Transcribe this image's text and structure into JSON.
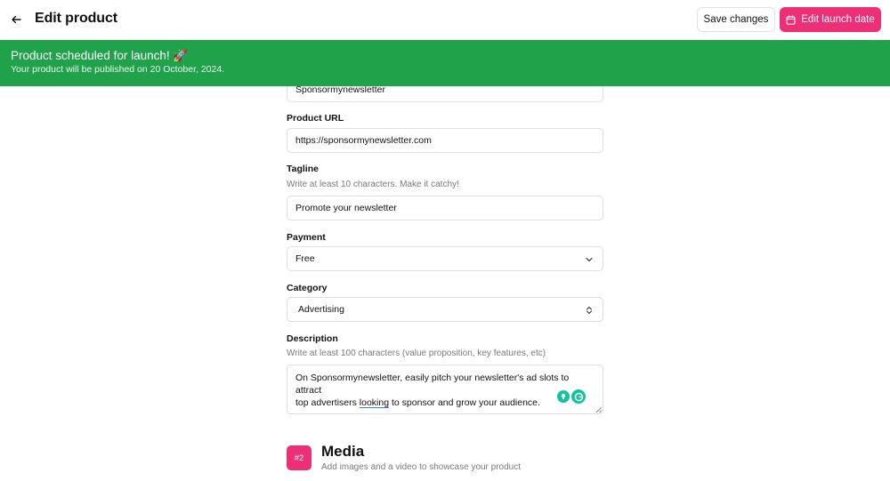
{
  "header": {
    "title": "Edit product",
    "save_label": "Save changes",
    "launch_label": "Edit launch date"
  },
  "banner": {
    "title": "Product scheduled for launch! 🚀",
    "subtitle": "Your product will be published on 20 October, 2024."
  },
  "form": {
    "name_value": "Sponsormynewsletter",
    "url": {
      "label": "Product URL",
      "value": "https://sponsormynewsletter.com"
    },
    "tagline": {
      "label": "Tagline",
      "hint": "Write at least 10 characters. Make it catchy!",
      "value": "Promote your newsletter"
    },
    "payment": {
      "label": "Payment",
      "value": "Free"
    },
    "category": {
      "label": "Category",
      "value": "Advertising"
    },
    "description": {
      "label": "Description",
      "hint": "Write at least 100 characters (value proposition, key features, etc)",
      "line1": "On Sponsormynewsletter, easily pitch your newsletter's ad slots to attract",
      "line2_pre": "top advertisers ",
      "line2_mid": "looking",
      "line2_post": " to sponsor and grow your audience."
    }
  },
  "media": {
    "badge": "#2",
    "title": "Media",
    "subtitle": "Add images and a video to showcase your product"
  },
  "colors": {
    "accent": "#ec2f77",
    "banner": "#20a24b",
    "grammarly": "#15c39a"
  },
  "icons": [
    "arrow-left-icon",
    "calendar-icon",
    "chevron-down-icon",
    "chevron-up-down-icon",
    "grammarly-icon",
    "resize-handle-icon"
  ]
}
